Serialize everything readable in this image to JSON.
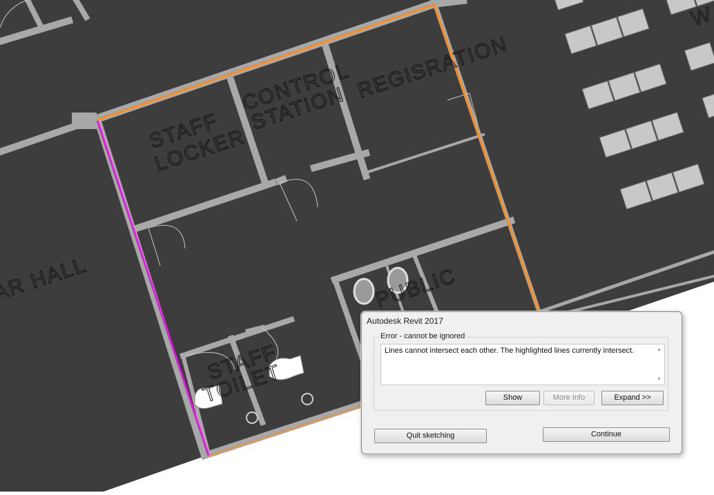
{
  "rooms": {
    "staff_locker_1": "STAFF",
    "staff_locker_2": "LOCKER",
    "control_station_1": "CONTROL",
    "control_station_2": "STATION",
    "registration": "REGISRATION",
    "hall": "AR  HALL",
    "public_toilet_1": "PUBLIC",
    "staff_toilet_1": "STAFF",
    "staff_toilet_2": "TOILET",
    "corner_w": "W"
  },
  "highlight_colors": {
    "orange_line": "#ff8c1a",
    "magenta_line": "#e21ae2"
  },
  "dialog": {
    "title": "Autodesk Revit 2017",
    "group_label": "Error - cannot be ignored",
    "message": "Lines cannot intersect each other. The highlighted lines currently intersect.",
    "scroll_up_icon": "▲",
    "scroll_down_icon": "▼",
    "buttons": {
      "show": "Show",
      "more_info": "More Info",
      "expand": "Expand >>",
      "quit_sketching": "Quit sketching",
      "continue": "Continue"
    }
  }
}
